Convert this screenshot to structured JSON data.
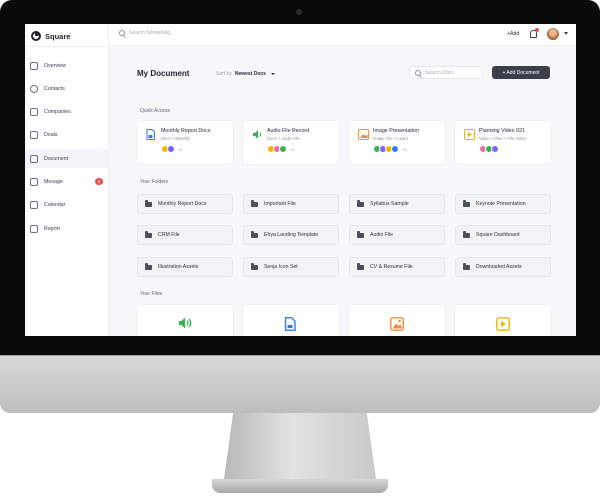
{
  "app": {
    "name": "Square"
  },
  "topbar": {
    "search_placeholder": "Search Something...",
    "add_label": "+Add"
  },
  "sidebar": {
    "items": [
      {
        "label": "Overview"
      },
      {
        "label": "Contacts"
      },
      {
        "label": "Companies"
      },
      {
        "label": "Deals"
      },
      {
        "label": "Document"
      },
      {
        "label": "Mesage",
        "badge": "6"
      },
      {
        "label": "Calendar"
      },
      {
        "label": "Report"
      }
    ]
  },
  "main": {
    "title": "My Document",
    "sort_label": "Sort by",
    "sort_value": "Newest Docs",
    "search_placeholder": "Search Docs",
    "add_button": "+ Add Document",
    "quick_access_label": "Quick Access",
    "quick_access": [
      {
        "title": "Monthly Report Docs",
        "path": "Docs > Monthly",
        "more": "+2",
        "icon": "document-icon",
        "color": "#2f7cf6"
      },
      {
        "title": "Audio File Record",
        "path": "Docs > Audio File",
        "more": "+2",
        "icon": "audio-icon",
        "color": "#37b24d"
      },
      {
        "title": "Image Presentation",
        "path": "Image File > Learn",
        "more": "+4",
        "icon": "image-icon",
        "color": "#f08c3a"
      },
      {
        "title": "Planning Video 021",
        "path": "Video > Plan > File Video",
        "more": "",
        "icon": "video-icon",
        "color": "#f5b400"
      }
    ],
    "folders_label": "Your Folders",
    "folders": [
      "Monthly Report Docs",
      "Important File",
      "Syllabus Sample",
      "Keynote Presentation",
      "CRM File",
      "Ehya Landing Template",
      "Audio File",
      "Square Dashboard",
      "Illustration Assets",
      "Senja Icon Set",
      "CV & Resume File",
      "Downloaded Assets"
    ],
    "files_label": "Your Files",
    "files": [
      {
        "icon": "audio-icon",
        "color": "#37b24d"
      },
      {
        "icon": "document-icon",
        "color": "#2f7cf6"
      },
      {
        "icon": "image-icon",
        "color": "#f08c3a"
      },
      {
        "icon": "video-icon",
        "color": "#f5b400"
      }
    ]
  }
}
